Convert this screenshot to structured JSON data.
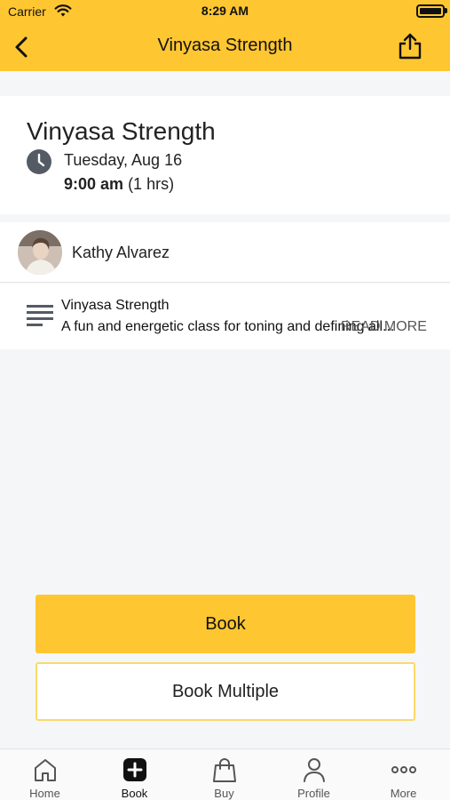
{
  "status_bar": {
    "carrier": "Carrier",
    "time": "8:29 AM"
  },
  "header": {
    "title": "Vinyasa Strength",
    "background_color": "#fec631"
  },
  "class_info": {
    "title": "Vinyasa Strength",
    "date": "Tuesday, Aug 16",
    "start_time": "9:00 am",
    "duration": "(1 hrs)"
  },
  "instructor": {
    "name": "Kathy Alvarez"
  },
  "description": {
    "title": "Vinyasa Strength",
    "text": "A fun and energetic class for toning and defining all...",
    "read_more": "READ MORE"
  },
  "actions": {
    "book_label": "Book",
    "book_multiple_label": "Book Multiple"
  },
  "tabs": [
    {
      "label": "Home",
      "icon": "home-icon"
    },
    {
      "label": "Book",
      "icon": "plus-square-icon"
    },
    {
      "label": "Buy",
      "icon": "shopping-bag-icon"
    },
    {
      "label": "Profile",
      "icon": "person-icon"
    },
    {
      "label": "More",
      "icon": "more-dots-icon"
    }
  ]
}
